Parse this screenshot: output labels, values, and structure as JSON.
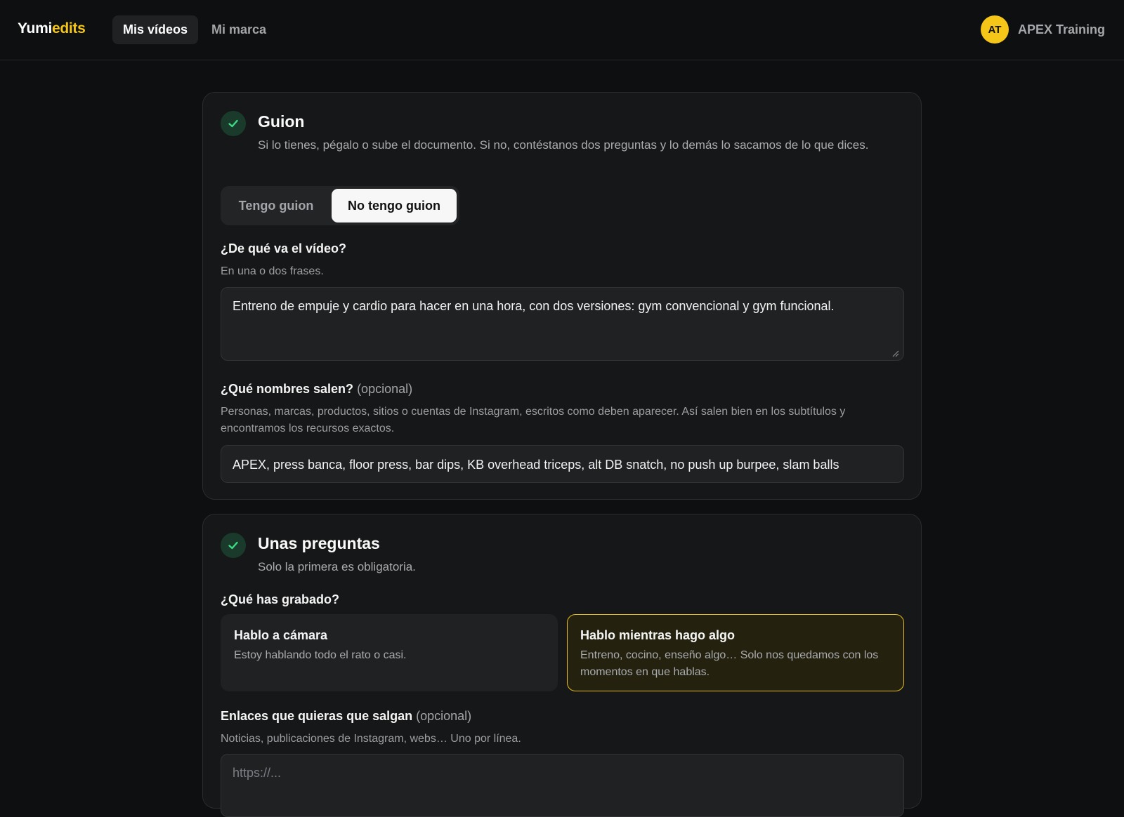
{
  "app": {
    "logo_part1": "Yumi",
    "logo_part2": "edits",
    "accent_color": "#f5c518"
  },
  "nav": {
    "items": [
      {
        "label": "Mis vídeos",
        "active": true
      },
      {
        "label": "Mi marca",
        "active": false
      }
    ]
  },
  "user": {
    "initials": "AT",
    "name": "APEX Training"
  },
  "guion": {
    "title": "Guion",
    "subtitle": "Si lo tienes, pégalo o sube el documento. Si no, contéstanos dos preguntas y lo demás lo sacamos de lo que dices.",
    "completed_icon": "check-icon",
    "toggle": {
      "options": [
        "Tengo guion",
        "No tengo guion"
      ],
      "selected": "No tengo guion"
    },
    "topic": {
      "label": "¿De qué va el vídeo?",
      "help": "En una o dos frases.",
      "value": "Entreno de empuje y cardio para hacer en una hora, con dos versiones: gym convencional y gym funcional."
    },
    "names": {
      "label": "¿Qué nombres salen?",
      "optional": "(opcional)",
      "help": "Personas, marcas, productos, sitios o cuentas de Instagram, escritos como deben aparecer. Así salen bien en los subtítulos y encontramos los recursos exactos.",
      "value": "APEX, press banca, floor press, bar dips, KB overhead triceps, alt DB snatch, no push up burpee, slam balls"
    }
  },
  "preguntas": {
    "title": "Unas preguntas",
    "subtitle": "Solo la primera es obligatoria.",
    "completed_icon": "check-icon",
    "recorded": {
      "label": "¿Qué has grabado?",
      "options": [
        {
          "title": "Hablo a cámara",
          "desc": "Estoy hablando todo el rato o casi.",
          "selected": false
        },
        {
          "title": "Hablo mientras hago algo",
          "desc": "Entreno, cocino, enseño algo… Solo nos quedamos con los momentos en que hablas.",
          "selected": true
        }
      ]
    },
    "links": {
      "label": "Enlaces que quieras que salgan",
      "optional": "(opcional)",
      "help": "Noticias, publicaciones de Instagram, webs… Uno por línea.",
      "placeholder": "https://..."
    }
  }
}
